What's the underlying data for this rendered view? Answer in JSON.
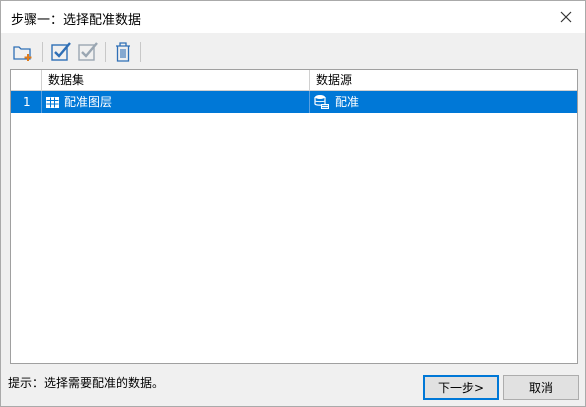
{
  "window": {
    "title": "步骤一：选择配准数据"
  },
  "toolbar": {
    "buttons": [
      {
        "icon": "add-folder-icon"
      },
      {
        "icon": "check-all-icon"
      },
      {
        "icon": "check-icon"
      },
      {
        "icon": "delete-icon"
      }
    ]
  },
  "grid": {
    "columns": [
      "",
      "数据集",
      "数据源"
    ],
    "rows": [
      {
        "index": "1",
        "dataset": "配准图层",
        "datasource": "配准",
        "selected": true
      }
    ]
  },
  "footer": {
    "hint": "提示：选择需要配准的数据。",
    "next_label": "下一步>",
    "cancel_label": "取消"
  },
  "colors": {
    "selection": "#0078d7",
    "accent_orange": "#e07b1a",
    "icon_blue": "#2f6fb6"
  }
}
